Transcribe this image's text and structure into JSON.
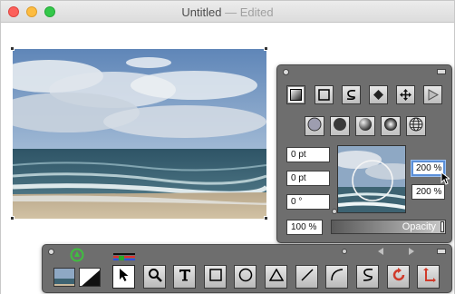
{
  "window": {
    "title": "Untitled",
    "title_suffix": "— Edited"
  },
  "style_panel": {
    "tools": [
      "gradient-fill-icon",
      "square-shape-icon",
      "freehand-curve-icon",
      "diamond-icon",
      "move-arrows-icon",
      "play-triangle-icon"
    ],
    "shading_options": [
      "plain-circle-icon",
      "solid-circle-icon",
      "sphere-shading-icon",
      "radial-shading-icon",
      "globe-icon"
    ],
    "fields": {
      "stroke_width": "0 pt",
      "offset": "0 pt",
      "angle": "0 °",
      "scale_x": "200 %",
      "scale_y": "200 %",
      "opacity_value": "100 %"
    },
    "opacity_label": "Opacity",
    "opacity_level": 1.0
  },
  "tool_palette": {
    "tools": [
      {
        "name": "select-arrow-tool",
        "icon": "arrow-pointer-icon",
        "selected": true
      },
      {
        "name": "magnify-tool",
        "icon": "magnifier-icon"
      },
      {
        "name": "text-tool",
        "icon": "text-t-icon"
      },
      {
        "name": "rectangle-tool",
        "icon": "rectangle-icon"
      },
      {
        "name": "ellipse-tool",
        "icon": "ellipse-icon"
      },
      {
        "name": "triangle-tool",
        "icon": "triangle-icon"
      },
      {
        "name": "line-tool",
        "icon": "line-icon"
      },
      {
        "name": "arc-tool",
        "icon": "arc-icon"
      },
      {
        "name": "freehand-tool",
        "icon": "freehand-s-icon"
      },
      {
        "name": "rotate-tool",
        "icon": "rotate-icon"
      },
      {
        "name": "flip-tool",
        "icon": "flip-arrows-icon"
      }
    ]
  },
  "colors": {
    "panel_bg": "#6e6e6e",
    "focus_ring": "#5b8fd8",
    "rotate_red": "#d03a2a",
    "app_green": "#3fbf3f"
  }
}
